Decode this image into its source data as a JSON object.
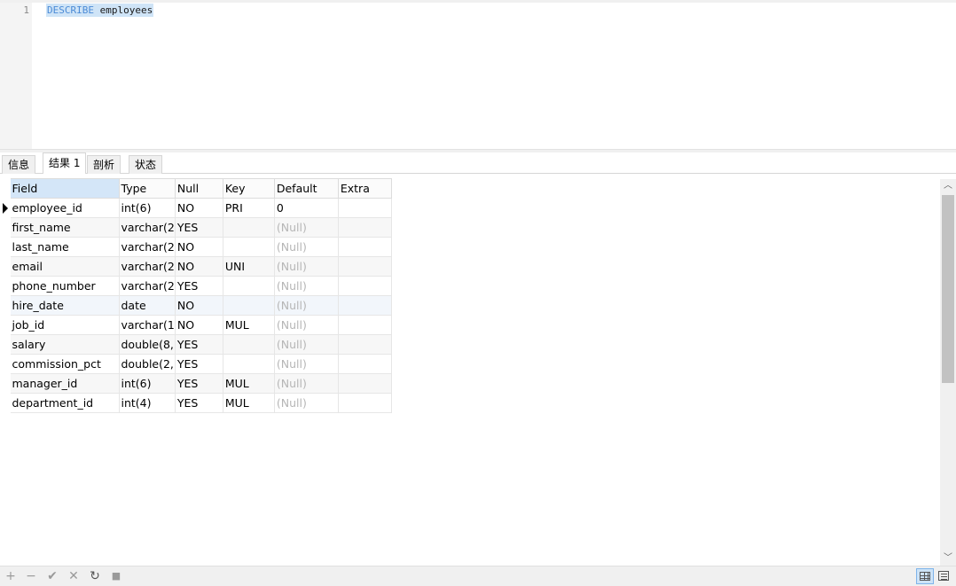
{
  "editor": {
    "line_number": "1",
    "keyword": "DESCRIBE",
    "identifier": "employees"
  },
  "tabs": [
    {
      "label": "信息"
    },
    {
      "label": "结果 1"
    },
    {
      "label": "剖析"
    },
    {
      "label": "状态"
    }
  ],
  "grid": {
    "columns": [
      "Field",
      "Type",
      "Null",
      "Key",
      "Default",
      "Extra"
    ],
    "rows": [
      [
        "employee_id",
        "int(6)",
        "NO",
        "PRI",
        "0",
        ""
      ],
      [
        "first_name",
        "varchar(2",
        "YES",
        "",
        "(Null)",
        ""
      ],
      [
        "last_name",
        "varchar(2",
        "NO",
        "",
        "(Null)",
        ""
      ],
      [
        "email",
        "varchar(2",
        "NO",
        "UNI",
        "(Null)",
        ""
      ],
      [
        "phone_number",
        "varchar(2",
        "YES",
        "",
        "(Null)",
        ""
      ],
      [
        "hire_date",
        "date",
        "NO",
        "",
        "(Null)",
        ""
      ],
      [
        "job_id",
        "varchar(1",
        "NO",
        "MUL",
        "(Null)",
        ""
      ],
      [
        "salary",
        "double(8,",
        "YES",
        "",
        "(Null)",
        ""
      ],
      [
        "commission_pct",
        "double(2,",
        "YES",
        "",
        "(Null)",
        ""
      ],
      [
        "manager_id",
        "int(6)",
        "YES",
        "MUL",
        "(Null)",
        ""
      ],
      [
        "department_id",
        "int(4)",
        "YES",
        "MUL",
        "(Null)",
        ""
      ]
    ]
  },
  "statusbar": {
    "icons": [
      "add-row-icon",
      "delete-row-icon",
      "apply-icon",
      "discard-icon",
      "refresh-icon",
      "stop-icon"
    ],
    "glyphs": [
      "+",
      "−",
      "✔",
      "✕",
      "↻",
      "■"
    ]
  }
}
